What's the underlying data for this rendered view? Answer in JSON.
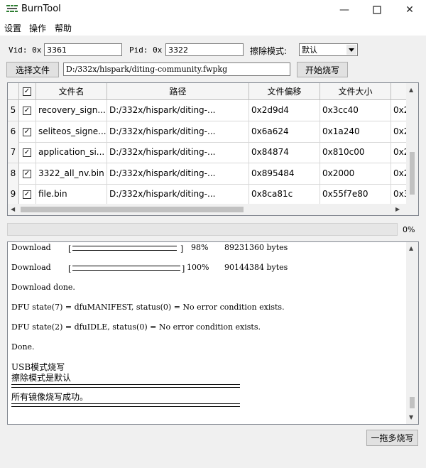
{
  "window": {
    "title": "BurnTool",
    "icon_text": "hisilicon tool",
    "controls": [
      "minimize-icon",
      "maximize-icon",
      "close-icon"
    ]
  },
  "menu": [
    "设置",
    "操作",
    "帮助"
  ],
  "form": {
    "vid_label": "Vid: 0x",
    "vid_value": "3361",
    "pid_label": "Pid: 0x",
    "pid_value": "3322",
    "erase_label": "擦除模式:",
    "erase_value": "默认",
    "select_file_label": "选择文件",
    "file_path": "D:/332x/hispark/diting-community.fwpkg",
    "start_label": "开始烧写"
  },
  "grid": {
    "columns": [
      "文件名",
      "路径",
      "文件偏移",
      "文件大小"
    ],
    "rows": [
      {
        "num": "5",
        "checked": true,
        "name": "recovery_sign...",
        "path": "D:/332x/hispark/diting-...",
        "offset": "0x2d9d4",
        "size": "0x3cc40",
        "extra": "0x2"
      },
      {
        "num": "6",
        "checked": true,
        "name": "seliteos_signe...",
        "path": "D:/332x/hispark/diting-...",
        "offset": "0x6a624",
        "size": "0x1a240",
        "extra": "0x2"
      },
      {
        "num": "7",
        "checked": true,
        "name": "application_si...",
        "path": "D:/332x/hispark/diting-...",
        "offset": "0x84874",
        "size": "0x810c00",
        "extra": "0x2"
      },
      {
        "num": "8",
        "checked": true,
        "name": "3322_all_nv.bin",
        "path": "D:/332x/hispark/diting-...",
        "offset": "0x895484",
        "size": "0x2000",
        "extra": "0x2"
      },
      {
        "num": "9",
        "checked": true,
        "name": "file.bin",
        "path": "D:/332x/hispark/diting-...",
        "offset": "0x8ca81c",
        "size": "0x55f7e80",
        "extra": "0x3"
      }
    ]
  },
  "progress": {
    "percent_text": "0%",
    "fraction": 0
  },
  "log": {
    "download1": {
      "label": "Download",
      "percent": "98%",
      "bytes": "89231360 bytes",
      "fraction": 0.98
    },
    "download2": {
      "label": "Download",
      "percent": "100%",
      "bytes": "90144384 bytes",
      "fraction": 1.0
    },
    "lines": [
      "Download done.",
      "DFU state(7) = dfuMANIFEST, status(0) = No error condition exists.",
      "DFU state(2) = dfuIDLE, status(0) = No error condition exists.",
      "Done.",
      "USB模式烧写",
      "擦除模式是默认",
      "所有镜像烧写成功。"
    ]
  },
  "multi_burn_label": "一拖多烧写"
}
